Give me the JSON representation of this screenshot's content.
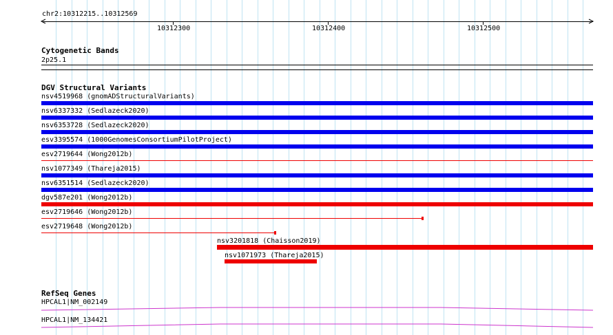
{
  "browser": {
    "location": "chr2:10312215..10312569",
    "ruler": {
      "labels": [
        "10312300",
        "10312400",
        "10312500"
      ]
    }
  },
  "tracks": {
    "cytoband": {
      "title": "Cytogenetic Bands",
      "band": "2p25.1"
    },
    "dgv": {
      "title": "DGV Structural Variants",
      "variants": [
        {
          "label": "nsv4519968 (gnomADStructuralVariants)",
          "color": "#0000ee",
          "style": "thick"
        },
        {
          "label": "nsv6337332 (Sedlazeck2020)",
          "color": "#0000ee",
          "style": "thick"
        },
        {
          "label": "nsv6353728 (Sedlazeck2020)",
          "color": "#0000ee",
          "style": "thick"
        },
        {
          "label": "esv3395574 (1000GenomesConsortiumPilotProject)",
          "color": "#0000ee",
          "style": "thick"
        },
        {
          "label": "esv2719644 (Wong2012b)",
          "color": "#ee0000",
          "style": "thin"
        },
        {
          "label": "nsv1077349 (Thareja2015)",
          "color": "#0000ee",
          "style": "thick"
        },
        {
          "label": "nsv6351514 (Sedlazeck2020)",
          "color": "#0000ee",
          "style": "thick"
        },
        {
          "label": "dgv587e201 (Wong2012b)",
          "color": "#ee0000",
          "style": "thick"
        },
        {
          "label": "esv2719646 (Wong2012b)",
          "color": "#ee0000",
          "style": "thin-cap"
        },
        {
          "label": "esv2719648 (Wong2012b)",
          "color": "#ee0000",
          "style": "thin-cap"
        },
        {
          "label": "nsv3201818 (Chaisson2019)",
          "color": "#ee0000",
          "style": "thick"
        },
        {
          "label": "nsv1071973 (Thareja2015)",
          "color": "#ee0000",
          "style": "thick"
        }
      ]
    },
    "refseq": {
      "title": "RefSeq Genes",
      "genes": [
        {
          "label": "HPCAL1|NM_002149",
          "color": "#cc33cc"
        },
        {
          "label": "HPCAL1|NM_134421",
          "color": "#cc33cc"
        }
      ]
    }
  }
}
